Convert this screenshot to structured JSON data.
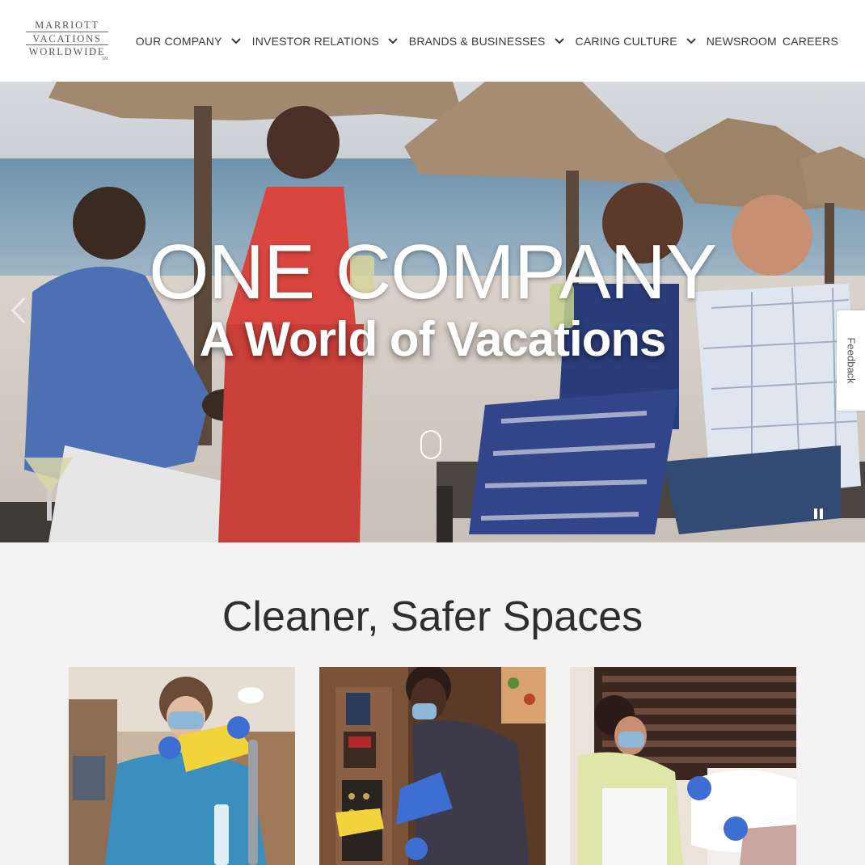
{
  "brand": {
    "logo_line1": "MARRIOTT",
    "logo_line2": "VACATIONS",
    "logo_line3": "WORLDWIDE",
    "logo_tm": "SM"
  },
  "nav": {
    "items": [
      {
        "label": "OUR COMPANY",
        "dropdown": true
      },
      {
        "label": "INVESTOR RELATIONS",
        "dropdown": true
      },
      {
        "label": "BRANDS & BUSINESSES",
        "dropdown": true
      },
      {
        "label": "CARING CULTURE",
        "dropdown": true
      },
      {
        "label": "NEWSROOM",
        "dropdown": false
      },
      {
        "label": "CAREERS",
        "dropdown": false
      }
    ]
  },
  "hero": {
    "title": "ONE COMPANY",
    "subtitle": "A World of Vacations",
    "image_icon": "beach-friends-photo"
  },
  "feedback": {
    "label": "Feedback"
  },
  "section": {
    "title": "Cleaner, Safer Spaces",
    "cards": [
      {
        "image_icon": "housekeeper-cleaning-faucet-photo"
      },
      {
        "image_icon": "staff-cleaning-elevator-photo"
      },
      {
        "image_icon": "housekeeper-arranging-pillows-photo"
      }
    ]
  },
  "colors": {
    "header_bg": "#ffffff",
    "nav_text": "#3a3a3a",
    "page_bg": "#f3f3f3",
    "hero_text": "#ffffff"
  }
}
